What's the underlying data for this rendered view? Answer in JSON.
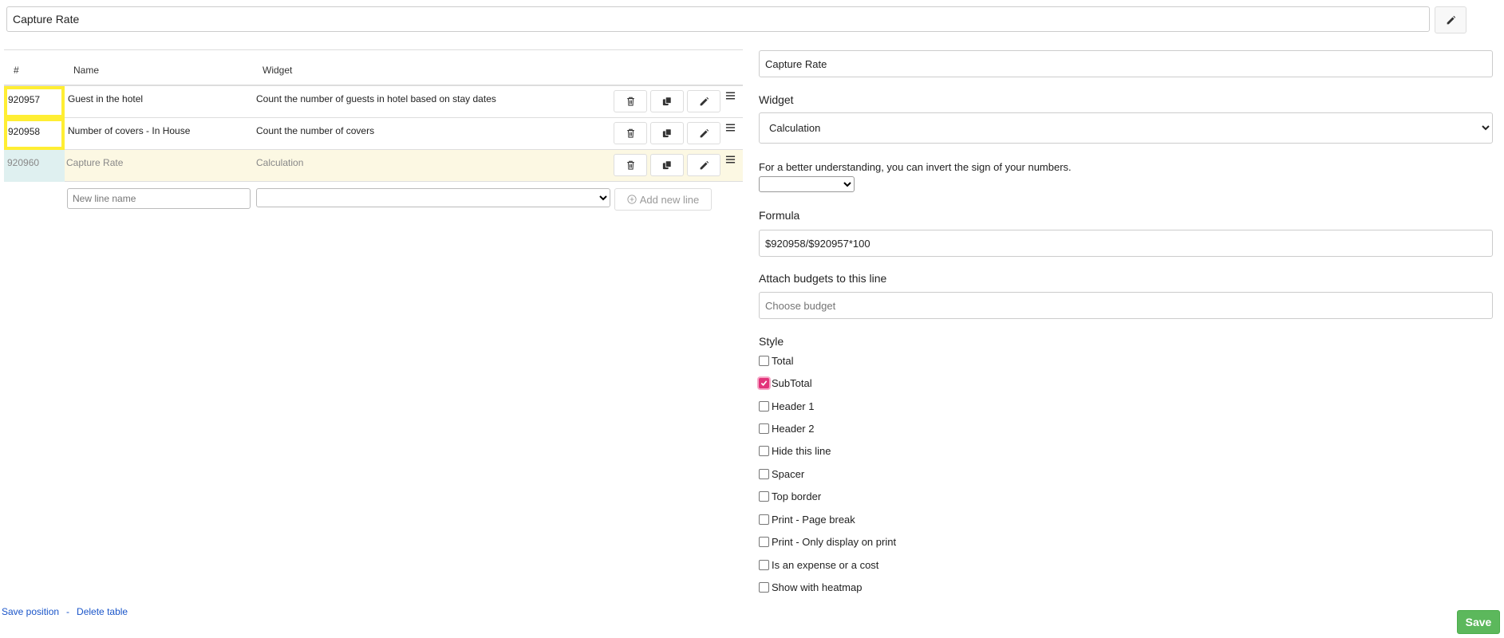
{
  "report": {
    "title": "Capture Rate"
  },
  "table": {
    "headers": {
      "id": "#",
      "name": "Name",
      "widget": "Widget"
    },
    "rows": [
      {
        "id": "920957",
        "name": "Guest in the hotel",
        "widget": "Count the number of guests in hotel based on stay dates"
      },
      {
        "id": "920958",
        "name": "Number of covers - In House",
        "widget": "Count the number of covers"
      },
      {
        "id": "920960",
        "name": "Capture Rate",
        "widget": "Calculation"
      }
    ],
    "new_line": {
      "name_placeholder": "New line name",
      "add_label": "Add new line"
    }
  },
  "footer": {
    "save_position": "Save position",
    "separator": "-",
    "delete_table": "Delete table"
  },
  "editor": {
    "line_name": "Capture Rate",
    "widget_label": "Widget",
    "widget_value": "Calculation",
    "invert_hint": "For a better understanding, you can invert the sign of your numbers.",
    "formula_label": "Formula",
    "formula_value": "$920958/$920957*100",
    "budgets_label": "Attach budgets to this line",
    "budgets_placeholder": "Choose budget",
    "style_label": "Style",
    "styles": [
      {
        "label": "Total",
        "checked": false
      },
      {
        "label": "SubTotal",
        "checked": true
      },
      {
        "label": "Header 1",
        "checked": false
      },
      {
        "label": "Header 2",
        "checked": false
      },
      {
        "label": "Hide this line",
        "checked": false
      },
      {
        "label": "Spacer",
        "checked": false
      },
      {
        "label": "Top border",
        "checked": false
      },
      {
        "label": "Print - Page break",
        "checked": false
      },
      {
        "label": "Print - Only display on print",
        "checked": false
      },
      {
        "label": "Is an expense or a cost",
        "checked": false
      },
      {
        "label": "Show with heatmap",
        "checked": false
      }
    ],
    "save_label": "Save"
  },
  "colors": {
    "highlight": "#ffee33",
    "active_row": "#fcf8e3",
    "link": "#1a55c9",
    "save": "#5cb85c",
    "checkbox_checked": "#e2337a"
  }
}
